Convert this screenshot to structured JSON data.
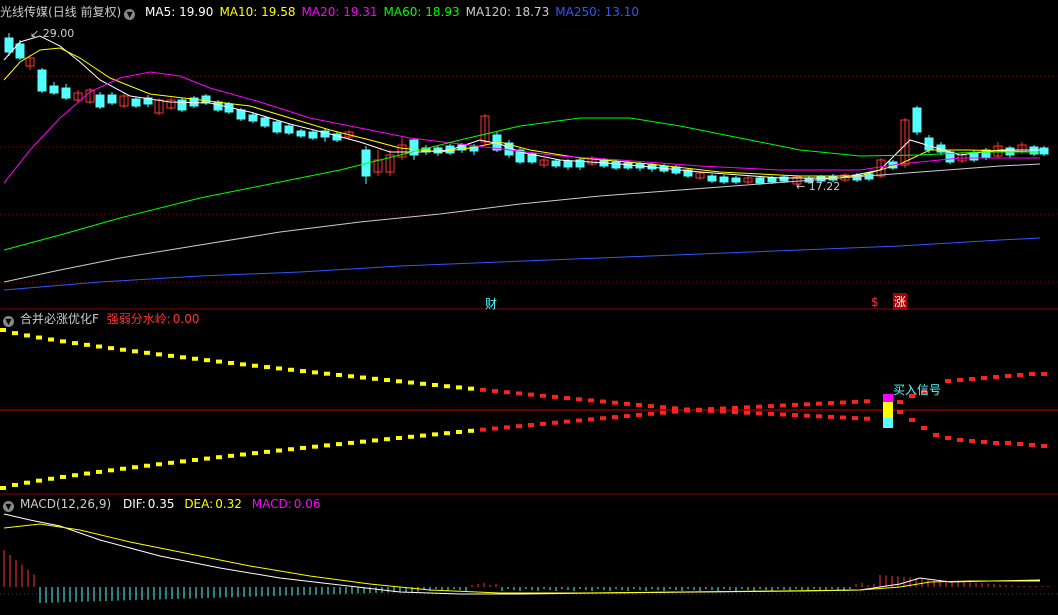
{
  "main": {
    "title": "光线传媒",
    "period": "(日线 前复权)",
    "ma": [
      {
        "label": "MA5:",
        "value": "19.90",
        "color": "#ffffff"
      },
      {
        "label": "MA10:",
        "value": "19.58",
        "color": "#ffff00"
      },
      {
        "label": "MA20:",
        "value": "19.31",
        "color": "#ff00ff"
      },
      {
        "label": "MA60:",
        "value": "18.93",
        "color": "#00ff00"
      },
      {
        "label": "MA120:",
        "value": "18.73",
        "color": "#cccccc"
      },
      {
        "label": "MA250:",
        "value": "13.10",
        "color": "#3355ff"
      }
    ],
    "high_label": "29.00",
    "low_label": "17.22",
    "marker_cai": "财",
    "marker_dollar": "$",
    "marker_zhang": "涨"
  },
  "indicator": {
    "name": "合并必涨优化F",
    "line_label": "强弱分水岭:",
    "line_value": "0.00",
    "signal_text": "买入信号"
  },
  "macd": {
    "name": "MACD(12,26,9)",
    "dif_label": "DIF:",
    "dif_value": "0.35",
    "dea_label": "DEA:",
    "dea_value": "0.32",
    "macd_label": "MACD:",
    "macd_value": "0.06"
  },
  "colors": {
    "up": "#ff3333",
    "down": "#54ffff",
    "ma5": "#ffffff",
    "ma10": "#ffff00",
    "ma20": "#ff00ff",
    "ma60": "#00ff00",
    "ma120": "#cccccc",
    "ma250": "#3355ff",
    "grid": "#8b0000",
    "dots_yellow": "#ffff00",
    "dots_red": "#ff2020"
  }
}
